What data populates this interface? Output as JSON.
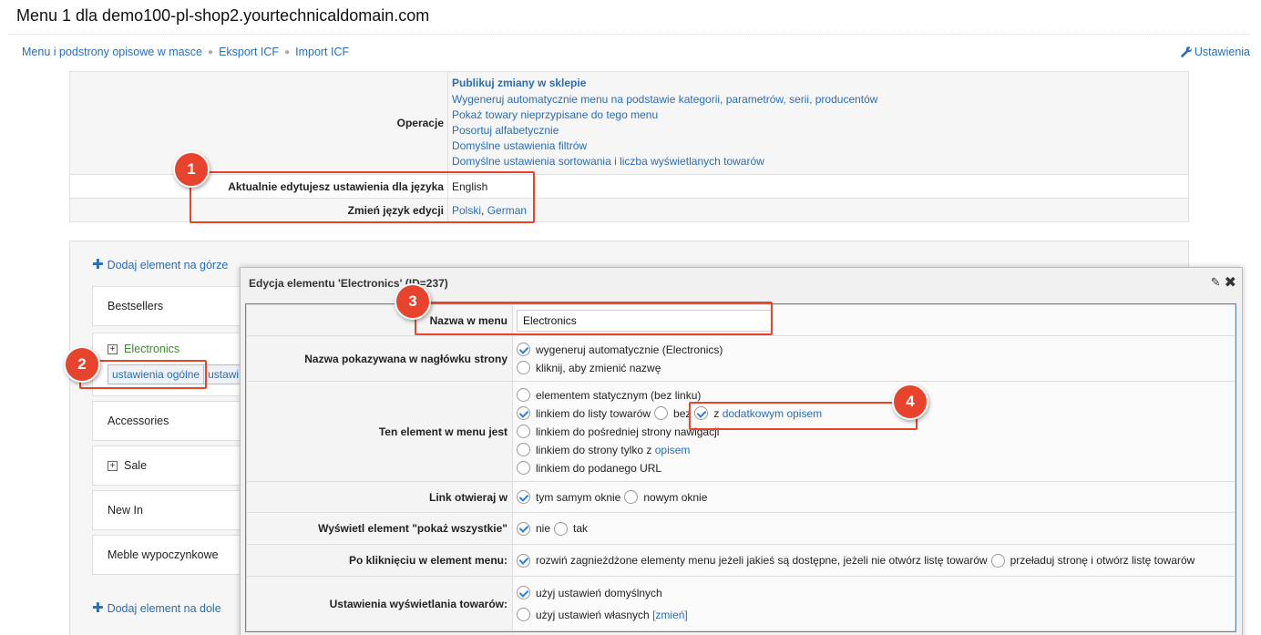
{
  "page": {
    "title": "Menu 1 dla demo100-pl-shop2.yourtechnicaldomain.com"
  },
  "topnav": {
    "items": [
      "Menu i podstrony opisowe w masce",
      "Eksport ICF",
      "Import ICF"
    ],
    "settings_label": "Ustawienia"
  },
  "ops": {
    "operations_label": "Operacje",
    "links": [
      "Publikuj zmiany w sklepie",
      "Wygeneruj automatycznie menu na podstawie kategorii, parametrów, serii, producentów",
      "Pokaż towary nieprzypisane do tego menu",
      "Posortuj alfabetycznie",
      "Domyślne ustawienia filtrów",
      "Domyślne ustawienia sortowania i liczba wyświetlanych towarów"
    ],
    "current_lang_label": "Aktualnie edytujesz ustawienia dla języka",
    "current_lang_value": "English",
    "change_lang_label": "Zmień język edycji",
    "lang_options": [
      "Polski",
      "German"
    ],
    "lang_sep": ","
  },
  "tree": {
    "add_top": "Dodaj element na górze",
    "add_bottom": "Dodaj element na dole",
    "items": [
      "Bestsellers",
      "Electronics",
      "Accessories",
      "Sale",
      "New In",
      "Meble wypoczynkowe"
    ],
    "subtabs": [
      "ustawienia ogólne",
      "ustawi"
    ],
    "expand_symbol": "+"
  },
  "modal": {
    "title": "Edycja elementu 'Electronics' (ID=237)",
    "name_label": "Nazwa w menu",
    "name_value": "Electronics",
    "header_name_label": "Nazwa pokazywana w nagłówku strony",
    "header_name_opt1": "wygeneruj automatycznie (Electronics)",
    "header_name_opt2": "kliknij, aby zmienić nazwę",
    "element_type_label": "Ten element w menu jest",
    "type_opt_static": "elementem statycznym (bez linku)",
    "type_opt_list": "linkiem do listy towarów",
    "type_opt_without": "bez",
    "type_opt_with_prefix": "z",
    "type_opt_with_link": "dodatkowym opisem",
    "type_opt_intermediate": "linkiem do pośredniej strony nawigacji",
    "type_opt_page_prefix": "linkiem do strony tylko z",
    "type_opt_page_link": "opisem",
    "type_opt_url": "linkiem do podanego URL",
    "open_in_label": "Link otwieraj w",
    "open_same": "tym samym oknie",
    "open_new": "nowym oknie",
    "show_all_label": "Wyświetl element \"pokaż wszystkie\"",
    "show_all_no": "nie",
    "show_all_yes": "tak",
    "on_click_label": "Po kliknięciu w element menu:",
    "on_click_opt1": "rozwiń zagnieżdżone elementy menu jeżeli jakieś są dostępne, jeżeli nie otwórz listę towarów",
    "on_click_opt2": "przeładuj stronę i otwórz listę towarów",
    "display_label": "Ustawienia wyświetlania towarów:",
    "display_opt1": "użyj ustawień domyślnych",
    "display_opt2": "użyj ustawień własnych",
    "display_change": "[zmień]"
  },
  "annotations": {
    "b1": "1",
    "b2": "2",
    "b3": "3",
    "b4": "4"
  },
  "colors": {
    "link": "#2a6db5",
    "annotation": "#e8442d",
    "electronics": "#3a8a2f"
  }
}
